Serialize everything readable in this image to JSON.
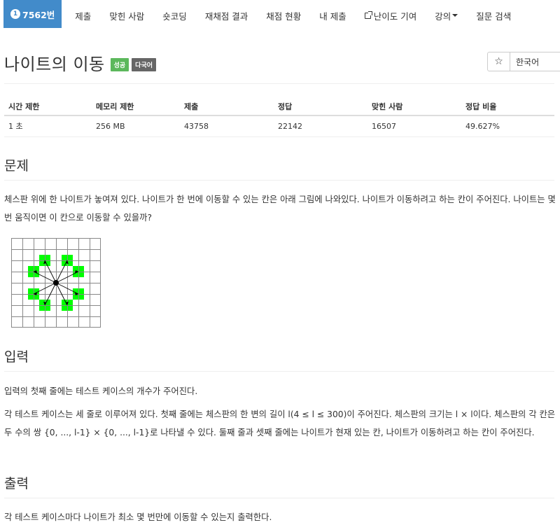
{
  "nav": {
    "problem_badge_icon": "1",
    "problem_id": "7562번",
    "items": [
      "제출",
      "맞힌 사람",
      "숏코딩",
      "재채점 결과",
      "채점 현황",
      "내 제출",
      "난이도 기여",
      "강의",
      "질문 검색"
    ]
  },
  "title": "나이트의 이동",
  "labels": {
    "success": "성공",
    "multilang": "다국어"
  },
  "controls": {
    "star": "☆",
    "language": "한국어"
  },
  "info_table": {
    "headers": [
      "시간 제한",
      "메모리 제한",
      "제출",
      "정답",
      "맞힌 사람",
      "정답 비율"
    ],
    "values": [
      "1 초",
      "256 MB",
      "43758",
      "22142",
      "16507",
      "49.627%"
    ]
  },
  "sections": {
    "problem": {
      "heading": "문제",
      "text": "체스판 위에 한 나이트가 놓여져 있다. 나이트가 한 번에 이동할 수 있는 칸은 아래 그림에 나와있다. 나이트가 이동하려고 하는 칸이 주어진다. 나이트는 몇 번 움직이면 이 칸으로 이동할 수 있을까?"
    },
    "input": {
      "heading": "입력",
      "line1": "입력의 첫째 줄에는 테스트 케이스의 개수가 주어진다.",
      "line2": "각 테스트 케이스는 세 줄로 이루어져 있다. 첫째 줄에는 체스판의 한 변의 길이 l(4 ≤ l ≤ 300)이 주어진다. 체스판의 크기는 l × l이다. 체스판의 각 칸은 두 수의 쌍 {0, ..., l-1} × {0, ..., l-1}로 나타낼 수 있다. 둘째 줄과 셋째 줄에는 나이트가 현재 있는 칸, 나이트가 이동하려고 하는 칸이 주어진다."
    },
    "output": {
      "heading": "출력",
      "text": "각 테스트 케이스마다 나이트가 최소 몇 번만에 이동할 수 있는지 출력한다."
    }
  },
  "colors": {
    "nav_active": "#428bca",
    "success": "#5cb85c",
    "multilang": "#666666",
    "knight_square": "#00ff00"
  },
  "icons": {
    "external_link": "external-link-icon",
    "dropdown": "caret-down-icon",
    "star": "star-icon"
  }
}
